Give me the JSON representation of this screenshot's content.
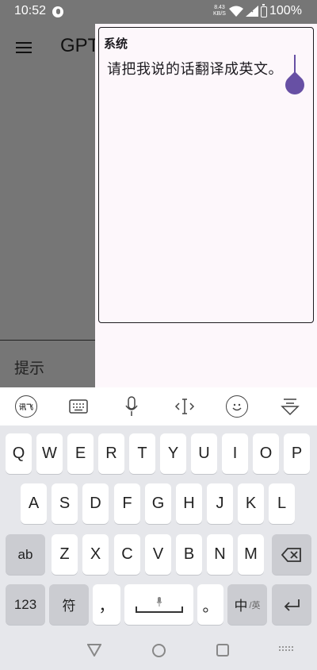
{
  "status_bar": {
    "time": "10:52",
    "net_speed": "8.43\nKB/S",
    "battery": "100%"
  },
  "app": {
    "title": "GPT",
    "prompt_label": "提示"
  },
  "editor": {
    "label": "系统",
    "text": "请把我说的话翻译成英文。"
  },
  "toolbar": {
    "ime_label": "讯飞"
  },
  "keyboard": {
    "row1": [
      "Q",
      "W",
      "E",
      "R",
      "T",
      "Y",
      "U",
      "I",
      "O",
      "P"
    ],
    "row2": [
      "A",
      "S",
      "D",
      "F",
      "G",
      "H",
      "J",
      "K",
      "L"
    ],
    "row3": [
      "Z",
      "X",
      "C",
      "V",
      "B",
      "N",
      "M"
    ],
    "shift_label": "ab",
    "num_label": "123",
    "symbol_label": "符",
    "comma_label": "，",
    "period_label": "。",
    "lang_label": "中",
    "lang_sub": "/英"
  },
  "colors": {
    "accent": "#6750a4",
    "scrim": "#767676",
    "sheet": "#fdf7fb",
    "keyboard_bg": "#e6e7eb"
  }
}
